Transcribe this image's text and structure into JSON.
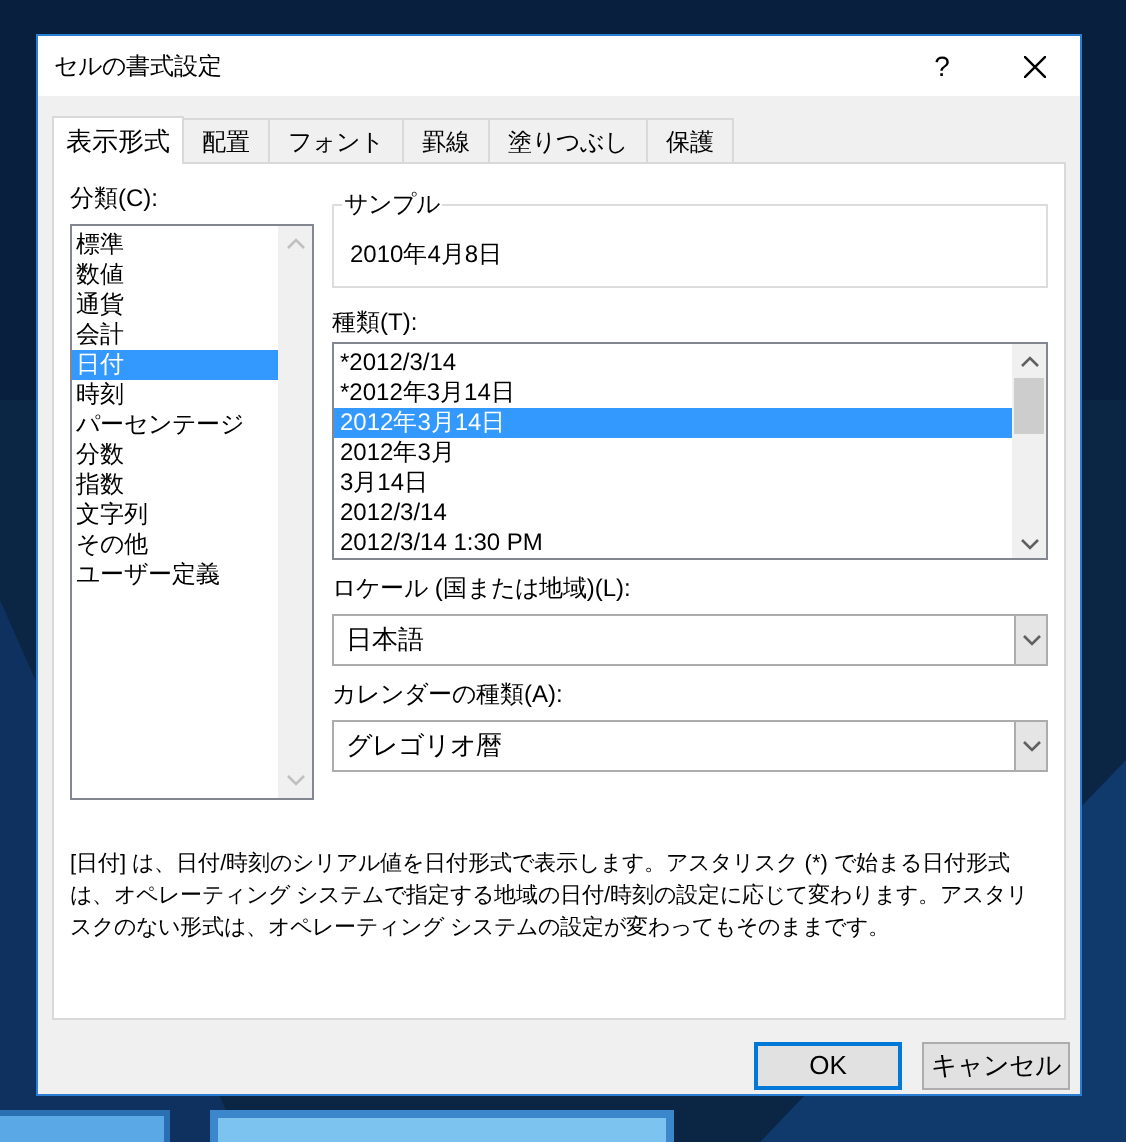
{
  "window": {
    "title": "セルの書式設定",
    "help": "?"
  },
  "tabs": [
    {
      "label": "表示形式",
      "selected": true
    },
    {
      "label": "配置",
      "selected": false
    },
    {
      "label": "フォント",
      "selected": false
    },
    {
      "label": "罫線",
      "selected": false
    },
    {
      "label": "塗りつぶし",
      "selected": false
    },
    {
      "label": "保護",
      "selected": false
    }
  ],
  "category": {
    "label": "分類(C):",
    "items": [
      {
        "label": "標準",
        "selected": false
      },
      {
        "label": "数値",
        "selected": false
      },
      {
        "label": "通貨",
        "selected": false
      },
      {
        "label": "会計",
        "selected": false
      },
      {
        "label": "日付",
        "selected": true
      },
      {
        "label": "時刻",
        "selected": false
      },
      {
        "label": "パーセンテージ",
        "selected": false
      },
      {
        "label": "分数",
        "selected": false
      },
      {
        "label": "指数",
        "selected": false
      },
      {
        "label": "文字列",
        "selected": false
      },
      {
        "label": "その他",
        "selected": false
      },
      {
        "label": "ユーザー定義",
        "selected": false
      }
    ]
  },
  "sample": {
    "label": "サンプル",
    "value": "2010年4月8日"
  },
  "type": {
    "label": "種類(T):",
    "items": [
      {
        "label": "*2012/3/14",
        "selected": false
      },
      {
        "label": "*2012年3月14日",
        "selected": false
      },
      {
        "label": "2012年3月14日",
        "selected": true
      },
      {
        "label": "2012年3月",
        "selected": false
      },
      {
        "label": "3月14日",
        "selected": false
      },
      {
        "label": "2012/3/14",
        "selected": false
      },
      {
        "label": "2012/3/14 1:30 PM",
        "selected": false
      }
    ]
  },
  "locale": {
    "label": "ロケール (国または地域)(L):",
    "value": "日本語"
  },
  "calendar": {
    "label": "カレンダーの種類(A):",
    "value": "グレゴリオ暦"
  },
  "description": "[日付] は、日付/時刻のシリアル値を日付形式で表示します。アスタリスク (*) で始まる日付形式は、オペレーティング システムで指定する地域の日付/時刻の設定に応じて変わります。アスタリスクのない形式は、オペレーティング システムの設定が変わってもそのままです。",
  "buttons": [
    {
      "label": "OK",
      "default": true
    },
    {
      "label": "キャンセル",
      "default": false
    }
  ]
}
